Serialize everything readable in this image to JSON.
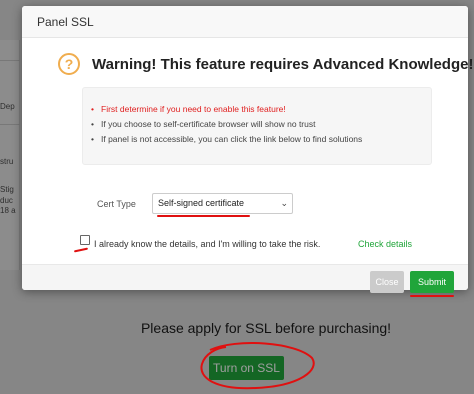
{
  "background": {
    "strip_texts": [
      "Dep",
      "stru",
      "Stig",
      "duc",
      "18 a"
    ],
    "apply_message": "Please apply for SSL before purchasing!",
    "turn_on_label": "Turn on SSL"
  },
  "dialog": {
    "title": "Panel SSL",
    "warning_icon_glyph": "?",
    "warning_title": "Warning! This feature requires Advanced Knowledge!",
    "notes": [
      "First determine if you need to enable this feature!",
      "If you choose to self-certificate browser will show no trust",
      "If panel is not accessible, you can click the link below to find solutions"
    ],
    "cert_type_label": "Cert Type",
    "cert_type_value": "Self-signed certificate",
    "agree_text": "I already know the details, and I'm willing to take the risk.",
    "check_details_label": "Check details",
    "close_label": "Close",
    "submit_label": "Submit"
  },
  "colors": {
    "accent_green": "#20a53a",
    "warning_red": "#e02020",
    "warning_icon": "#f0ad4e",
    "annotation_red": "#e01010"
  }
}
